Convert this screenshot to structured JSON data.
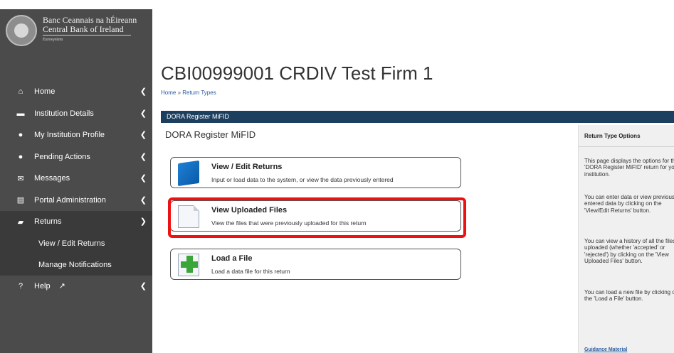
{
  "logo": {
    "line1": "Banc Ceannais na hÉireann",
    "line2": "Central Bank of Ireland",
    "line3": "Eurosystem"
  },
  "sidebar": {
    "items": [
      {
        "label": "Home",
        "icon": "home-icon",
        "glyph": "⌂"
      },
      {
        "label": "Institution Details",
        "icon": "briefcase-icon",
        "glyph": "▬"
      },
      {
        "label": "My Institution Profile",
        "icon": "user-icon",
        "glyph": "●"
      },
      {
        "label": "Pending Actions",
        "icon": "alert-icon",
        "glyph": "●"
      },
      {
        "label": "Messages",
        "icon": "envelope-icon",
        "glyph": "✉"
      },
      {
        "label": "Portal Administration",
        "icon": "list-icon",
        "glyph": "▤"
      },
      {
        "label": "Returns",
        "icon": "folder-open-icon",
        "glyph": "▰"
      }
    ],
    "sub_items": [
      {
        "label": "View / Edit Returns"
      },
      {
        "label": "Manage Notifications"
      }
    ],
    "help": {
      "label": "Help",
      "icon": "question-icon",
      "glyph": "?"
    }
  },
  "main": {
    "title": "CBI00999001 CRDIV Test Firm 1",
    "breadcrumb": {
      "home": "Home",
      "separator": "»",
      "current": "Return Types"
    },
    "bar_label": "DORA Register MiFID",
    "section_title": "DORA Register MiFID",
    "actions": [
      {
        "title": "View / Edit Returns",
        "desc": "Input or load data to the system, or view the data previously entered",
        "icon": "folder-icon"
      },
      {
        "title": "View Uploaded Files",
        "desc": "View the files that were previously uploaded for this return",
        "icon": "document-icon"
      },
      {
        "title": "Load a File",
        "desc": "Load a data file for this return",
        "icon": "add-file-icon"
      }
    ]
  },
  "right_panel": {
    "heading": "Return Type Options",
    "paragraphs": [
      "This page displays the options for the 'DORA Register MiFID' return for your institution.",
      "You can enter data or view previously entered data by clicking on the 'View/Edit Returns' button.",
      "You can view a history of all the files uploaded (whether 'accepted' or 'rejected') by clicking on the 'View Uploaded Files' button.",
      "You can load a new file by clicking on the 'Load a File' button."
    ],
    "guidance_link": "Guidance Material"
  },
  "colors": {
    "sidebar_bg": "#4b4b4b",
    "bar_bg": "#1c3f5f",
    "highlight": "#ee1111",
    "link": "#2a5d9f"
  }
}
